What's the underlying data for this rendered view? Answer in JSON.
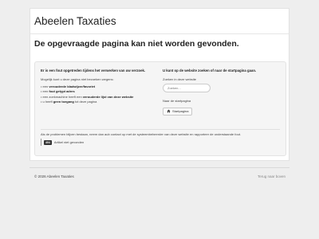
{
  "brand": {
    "name": "Abeelen Taxaties"
  },
  "page": {
    "title": "De opgevraagde pagina kan niet worden gevonden."
  },
  "error_panel": {
    "heading": "Er is een fout opgetreden tijdens het verwerken van uw verzoek.",
    "intro": "Mogelijk kunt u deze pagina niet bezoeken wegens:",
    "reasons": [
      {
        "prefix": "een ",
        "emphasis": "verouderde bladwijzer/favoriet",
        "suffix": ""
      },
      {
        "prefix": "een ",
        "emphasis": "fout getypt adres",
        "suffix": ""
      },
      {
        "prefix": "een zoekmachine heeft een ",
        "emphasis": "verouderde lijst van deze website",
        "suffix": ""
      },
      {
        "prefix": "u heeft ",
        "emphasis": "geen toegang",
        "suffix": " tot deze pagina"
      }
    ]
  },
  "search_panel": {
    "heading": "U kunt op de website zoeken of naar de startpagina gaan.",
    "search_label": "Zoeken in deze website",
    "search_placeholder": "Zoeken...",
    "home_label": "Naar de startpagina",
    "home_button": "Startpagina",
    "home_icon": "home-icon"
  },
  "contact_text": "Als de problemen blijven bestaan, neem dan aub contact op met de systeembeheerder van deze website en rapporteer de onderstaande fout.",
  "back": {
    "badge": "404",
    "label": "Artikel niet gevonden"
  },
  "footer": {
    "copyright": "© 2026 Abeelen Taxaties",
    "back_to_top": "Terug naar boven"
  },
  "colors": {
    "background": "#eeeeee",
    "panel": "#f5f5f5",
    "text": "#333333"
  }
}
